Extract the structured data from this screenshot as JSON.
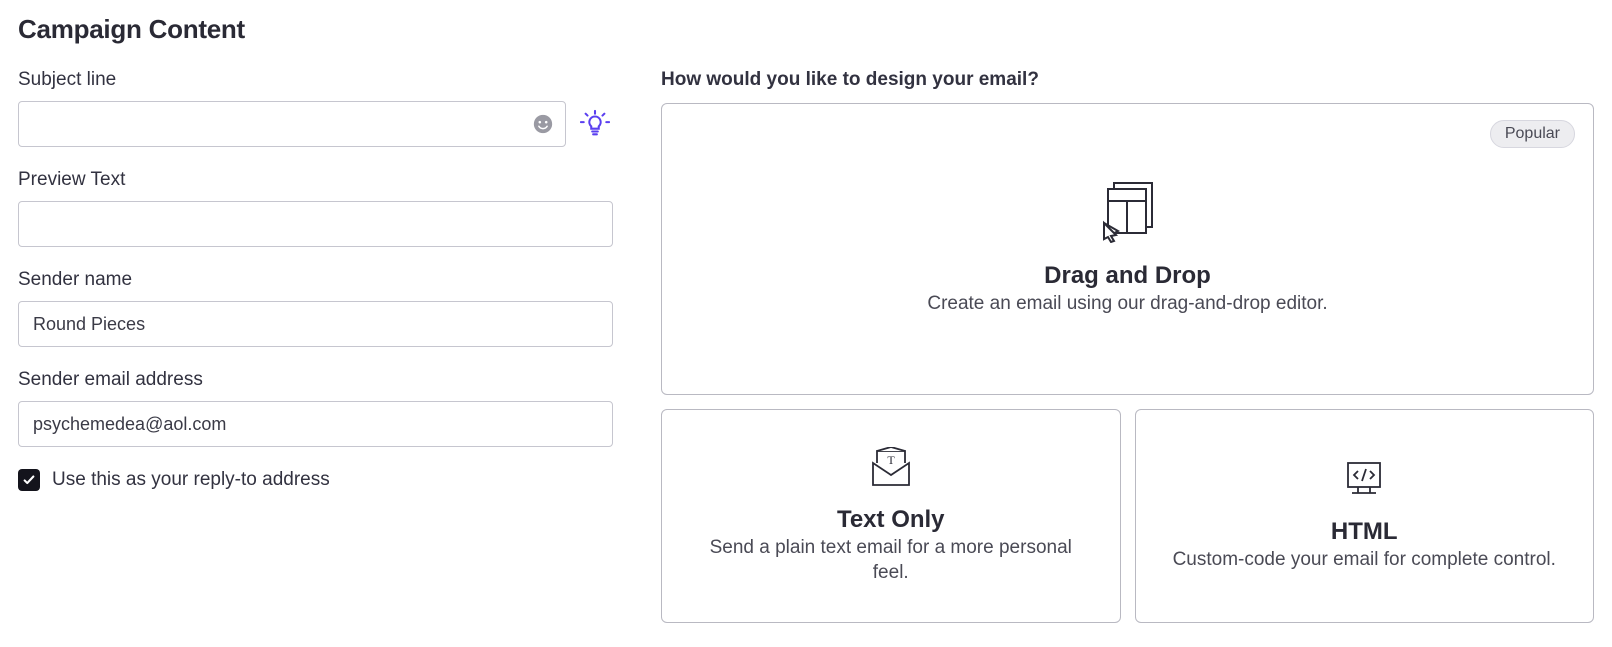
{
  "page_title": "Campaign Content",
  "form": {
    "subject": {
      "label": "Subject line",
      "value": ""
    },
    "preview": {
      "label": "Preview Text",
      "value": ""
    },
    "sender_name": {
      "label": "Sender name",
      "value": "Round Pieces"
    },
    "sender_email": {
      "label": "Sender email address",
      "value": "psychemedea@aol.com"
    },
    "reply_to_checkbox": {
      "label": "Use this as your reply-to address",
      "checked": true
    }
  },
  "design": {
    "heading": "How would you like to design your email?",
    "popular_badge": "Popular",
    "options": [
      {
        "title": "Drag and Drop",
        "desc": "Create an email using our drag-and-drop editor."
      },
      {
        "title": "Text Only",
        "desc": "Send a plain text email for a more personal feel."
      },
      {
        "title": "HTML",
        "desc": "Custom-code your email for complete control."
      }
    ]
  }
}
